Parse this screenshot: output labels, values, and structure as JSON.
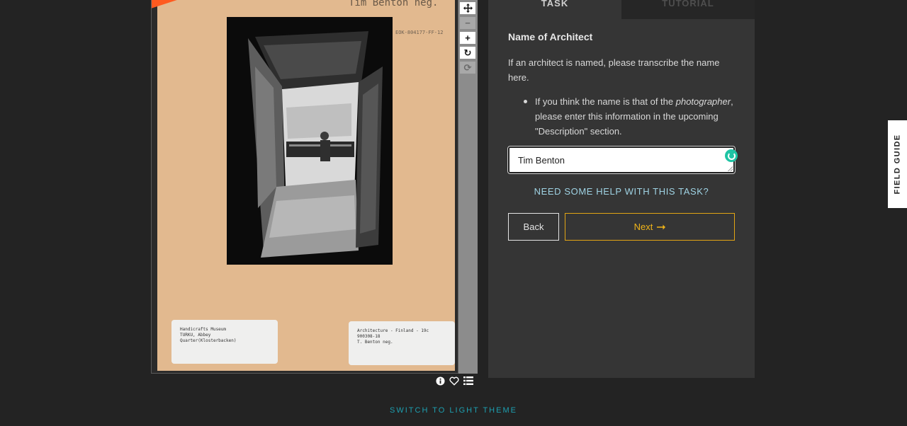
{
  "subject": {
    "negative_label": "Tim Benton neg.",
    "reference_code": "EOK-804177-FF-12",
    "label_left": "Handicrafts Museum\nTURKU, Abbey Quarter(Klosterbacken)",
    "label_right": "Architecture - Finland - 19c\n900308-18\nT. Benton neg."
  },
  "toolbar": {
    "move_icon": "move-icon",
    "zoom_out_icon": "zoom-out-icon",
    "zoom_in_icon": "zoom-in-icon",
    "rotate_icon": "rotate-icon",
    "reset_icon": "reset-icon"
  },
  "tabs": [
    {
      "label": "TASK",
      "active": true
    },
    {
      "label": "TUTORIAL",
      "active": false
    }
  ],
  "task": {
    "title": "Name of Architect",
    "instruction": "If an architect is named, please transcribe the name here.",
    "bullet_prefix": "If you think the name is that of the ",
    "bullet_emphasis": "photographer",
    "bullet_suffix": ", please enter this information in the upcoming \"Description\" section.",
    "answer_value": "Tim Benton",
    "help_link": "NEED SOME HELP WITH THIS TASK?",
    "back_label": "Back",
    "next_label": "Next"
  },
  "field_guide": "FIELD GUIDE",
  "theme_switch": "SWITCH TO LIGHT THEME",
  "colors": {
    "background": "#232323",
    "panel": "#353535",
    "next_accent": "#e2a515",
    "help_link": "#9fd3e4",
    "theme_link": "#1d9fb0",
    "status_dot": "#1fc4a4"
  }
}
